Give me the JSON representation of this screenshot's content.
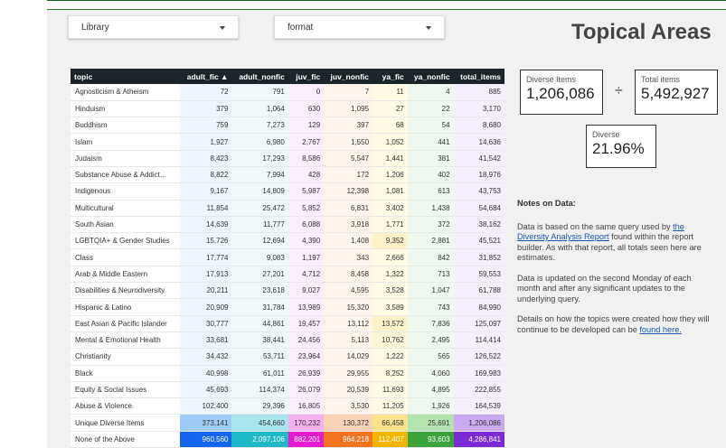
{
  "filters": {
    "library": "Library",
    "format": "format"
  },
  "title": "Topical Areas",
  "summary": {
    "diverse_items_label": "Diverse Items",
    "diverse_items_value": "1,206,086",
    "divide_symbol": "÷",
    "total_items_label": "Total items",
    "total_items_value": "5,492,927",
    "diverse_pct_label": "Diverse",
    "diverse_pct_value": "21.96%"
  },
  "table": {
    "headers": [
      "topic",
      "adult_fic ▲",
      "adult_nonfic",
      "juv_fic",
      "juv_nonfic",
      "ya_fic",
      "ya_nonfic",
      "total_items"
    ],
    "rows": [
      [
        "Agnosticism & Atheism",
        "72",
        "791",
        "0",
        "7",
        "11",
        "4",
        "885"
      ],
      [
        "Hinduism",
        "379",
        "1,064",
        "630",
        "1,095",
        "27",
        "22",
        "3,170"
      ],
      [
        "Buddhism",
        "759",
        "7,273",
        "129",
        "397",
        "68",
        "54",
        "8,680"
      ],
      [
        "Islam",
        "1,927",
        "6,980",
        "2,767",
        "1,550",
        "1,052",
        "441",
        "14,636"
      ],
      [
        "Judaism",
        "8,423",
        "17,293",
        "8,586",
        "5,547",
        "1,441",
        "381",
        "41,542"
      ],
      [
        "Substance Abuse & Addict...",
        "8,822",
        "7,994",
        "428",
        "172",
        "1,206",
        "402",
        "18,976"
      ],
      [
        "Indigenous",
        "9,167",
        "14,809",
        "5,987",
        "12,398",
        "1,081",
        "613",
        "43,753"
      ],
      [
        "Multicultural",
        "11,854",
        "25,472",
        "5,852",
        "6,831",
        "3,402",
        "1,438",
        "54,684"
      ],
      [
        "South Asian",
        "14,639",
        "11,777",
        "6,088",
        "3,918",
        "1,771",
        "372",
        "38,162"
      ],
      [
        "LGBTQIA+ & Gender Studies",
        "15,726",
        "12,694",
        "4,390",
        "1,408",
        "9,352",
        "2,881",
        "45,521"
      ],
      [
        "Class",
        "17,774",
        "9,083",
        "1,197",
        "343",
        "2,666",
        "842",
        "31,852"
      ],
      [
        "Arab & Middle Eastern",
        "17,913",
        "27,201",
        "4,712",
        "8,458",
        "1,322",
        "713",
        "59,553"
      ],
      [
        "Disabilities & Neurodiversity",
        "20,211",
        "23,618",
        "9,027",
        "4,595",
        "3,528",
        "1,047",
        "61,788"
      ],
      [
        "Hispanic & Latino",
        "20,909",
        "31,784",
        "13,989",
        "15,320",
        "3,589",
        "743",
        "84,990"
      ],
      [
        "East Asian & Pacific Islander",
        "30,777",
        "44,861",
        "19,457",
        "13,112",
        "13,572",
        "7,836",
        "125,097"
      ],
      [
        "Mental & Emotional Health",
        "33,681",
        "38,441",
        "24,456",
        "5,113",
        "10,762",
        "2,495",
        "114,414"
      ],
      [
        "Christianity",
        "34,432",
        "53,711",
        "23,964",
        "14,029",
        "1,222",
        "565",
        "126,522"
      ],
      [
        "Black",
        "40,998",
        "61,011",
        "26,939",
        "29,955",
        "8,252",
        "4,060",
        "169,983"
      ],
      [
        "Equity & Social Issues",
        "45,693",
        "114,374",
        "26,079",
        "20,539",
        "11,693",
        "4,895",
        "222,855"
      ],
      [
        "Abuse & Violence",
        "102,400",
        "29,396",
        "16,805",
        "3,530",
        "11,205",
        "1,926",
        "164,539"
      ]
    ],
    "unique_row": [
      "Unique Diverse Items",
      "373,141",
      "454,660",
      "170,232",
      "130,372",
      "66,458",
      "25,691",
      "1,206,086"
    ],
    "none_row": [
      "None of the Above",
      "960,560",
      "2,097,106",
      "882,201",
      "964,218",
      "112,407",
      "93,603",
      "4,286,841"
    ]
  },
  "colors": {
    "unique": [
      "#ffffff",
      "#9ecbf6",
      "#a8e6ee",
      "#f6b2f0",
      "#fbd1b8",
      "#fbe28c",
      "#b5e3b0",
      "#c9a9ef"
    ],
    "none": [
      "#ffffff",
      "#1565f0",
      "#1fb8c7",
      "#e41ad0",
      "#f27420",
      "#f5b400",
      "#3aa43a",
      "#7b2bd4"
    ]
  },
  "notes": {
    "heading": "Notes on Data:",
    "p1_before": "Data is based on the same query used by ",
    "p1_link": "the Diversity Analysis Report",
    "p1_after": " found within the report builder.  As with that report, all totals seen here are estimates.",
    "p2": "Data is updated on the second Monday of each month and after any significant updates to the underlying query.",
    "p3_before": "Details on how the topics were created how they will continue to be developed can be ",
    "p3_link": "found here."
  }
}
